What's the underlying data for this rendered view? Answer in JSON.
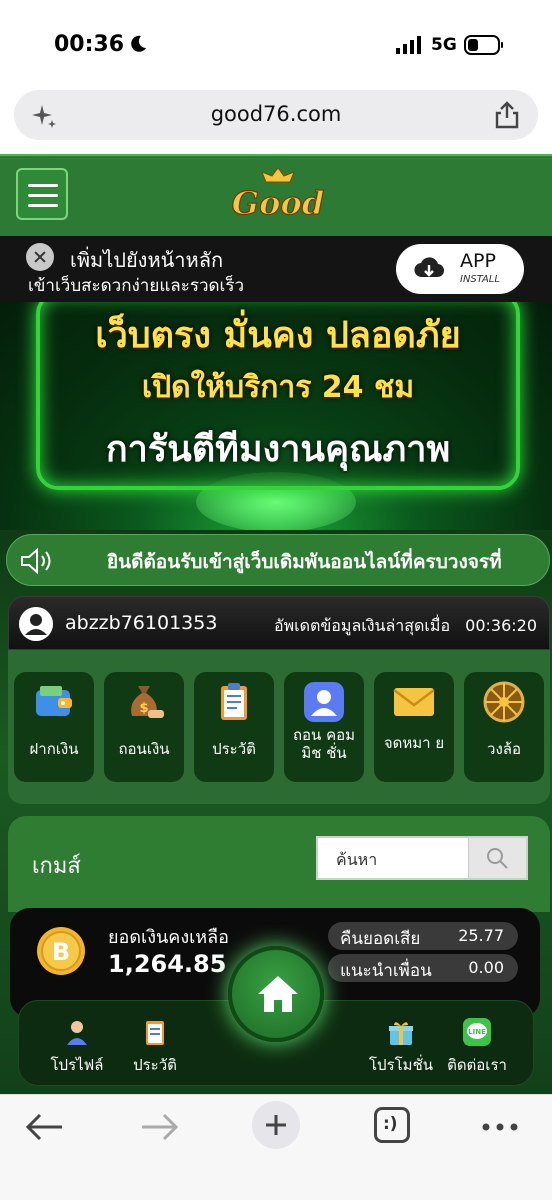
{
  "status_bar": {
    "time": "00:36",
    "network": "5G"
  },
  "browser": {
    "url": "good76.com"
  },
  "header": {
    "logo_text": "Good"
  },
  "add_to_home": {
    "title": "เพิ่มไปยังหน้าหลัก",
    "subtitle": "เข้าเว็บสะดวกง่ายและรวดเร็ว",
    "app_label": "APP",
    "install_label": "INSTALL"
  },
  "hero": {
    "line1": "เว็บตรง มั่นคง ปลอดภัย",
    "line2": "เปิดให้บริการ 24 ชม",
    "line3": "การันตีทีมงานคุณภาพ"
  },
  "marquee": {
    "text": "ยินดีต้อนรับเข้าสู่เว็บเดิมพันออนไลน์ที่ครบวงจรที่"
  },
  "user": {
    "username": "abzzb76101353",
    "updated_label": "อัพเดตข้อมูลเงินล่าสุดเมื่อ",
    "updated_time": "00:36:20"
  },
  "menu": [
    {
      "label": "ฝากเงิน",
      "icon": "wallet-icon"
    },
    {
      "label": "ถอนเงิน",
      "icon": "money-bag-icon"
    },
    {
      "label": "ประวัติ",
      "icon": "clipboard-icon"
    },
    {
      "label": "ถอน คอมมิช ชั่น",
      "icon": "user-badge-icon"
    },
    {
      "label": "จดหมา ย",
      "icon": "envelope-icon"
    },
    {
      "label": "วงล้อ",
      "icon": "wheel-icon"
    }
  ],
  "games": {
    "title": "เกมส์",
    "search_placeholder": "ค้นหา"
  },
  "balance": {
    "label": "ยอดเงินคงเหลือ",
    "value": "1,264.85",
    "cashback_label": "คืนยอดเสีย",
    "cashback_value": "25.77",
    "referral_label": "แนะนำเพื่อน",
    "referral_value": "0.00"
  },
  "bottom_nav": {
    "profile": "โปรไฟล์",
    "history": "ประวัติ",
    "promotion": "โปรโมชั่น",
    "contact": "ติดต่อเรา",
    "contact_badge": "LINE"
  },
  "colors": {
    "brand_green": "#2e7d32",
    "neon_green": "#36d23c",
    "gold": "#ffe24a"
  }
}
